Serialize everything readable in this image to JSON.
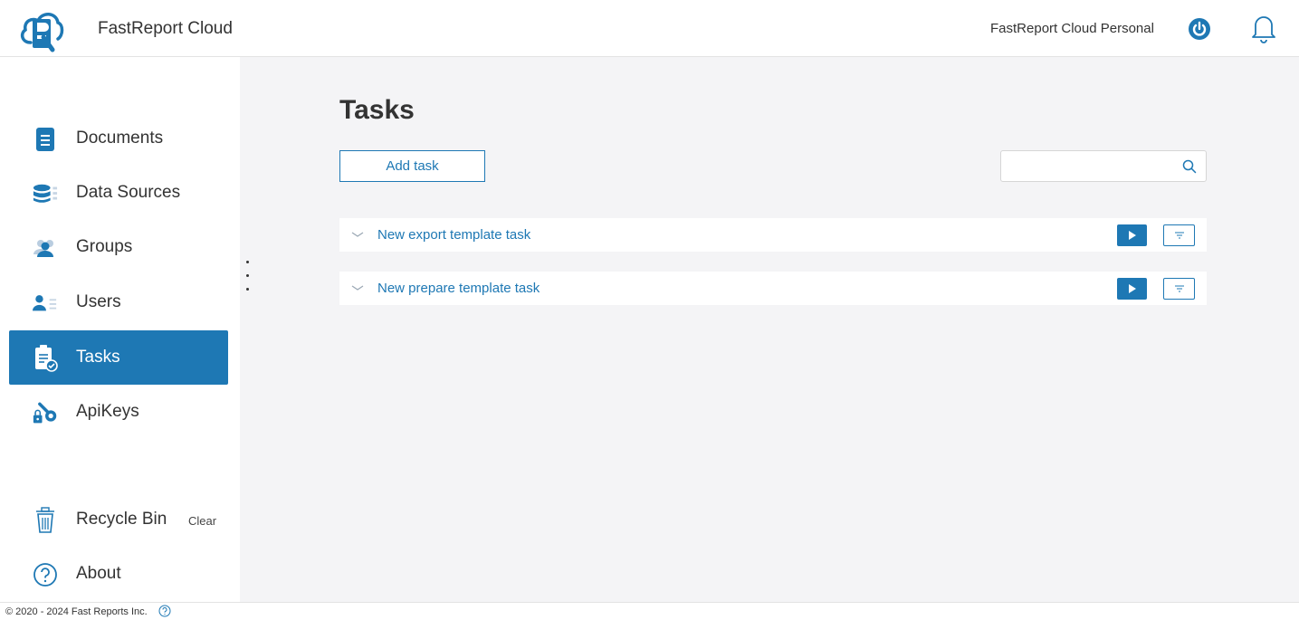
{
  "header": {
    "app_title": "FastReport Cloud",
    "account_name": "FastReport Cloud Personal"
  },
  "sidebar": {
    "items": [
      {
        "label": "Documents",
        "icon": "document-icon"
      },
      {
        "label": "Data Sources",
        "icon": "database-icon"
      },
      {
        "label": "Groups",
        "icon": "groups-icon"
      },
      {
        "label": "Users",
        "icon": "users-icon"
      },
      {
        "label": "Tasks",
        "icon": "tasks-icon",
        "active": true
      },
      {
        "label": "ApiKeys",
        "icon": "apikeys-icon"
      },
      {
        "label": "Recycle Bin",
        "icon": "recycle-bin-icon"
      },
      {
        "label": "About",
        "icon": "about-icon"
      }
    ],
    "clear_label": "Clear"
  },
  "main": {
    "title": "Tasks",
    "add_task_label": "Add task",
    "search": {
      "value": "",
      "placeholder": ""
    },
    "tasks": [
      {
        "name": "New export template task"
      },
      {
        "name": "New prepare template task"
      }
    ]
  },
  "footer": {
    "copyright": "© 2020 - 2024 Fast Reports Inc."
  },
  "colors": {
    "accent": "#1e78b4",
    "main_bg": "#f4f4f6",
    "text": "#333333"
  }
}
